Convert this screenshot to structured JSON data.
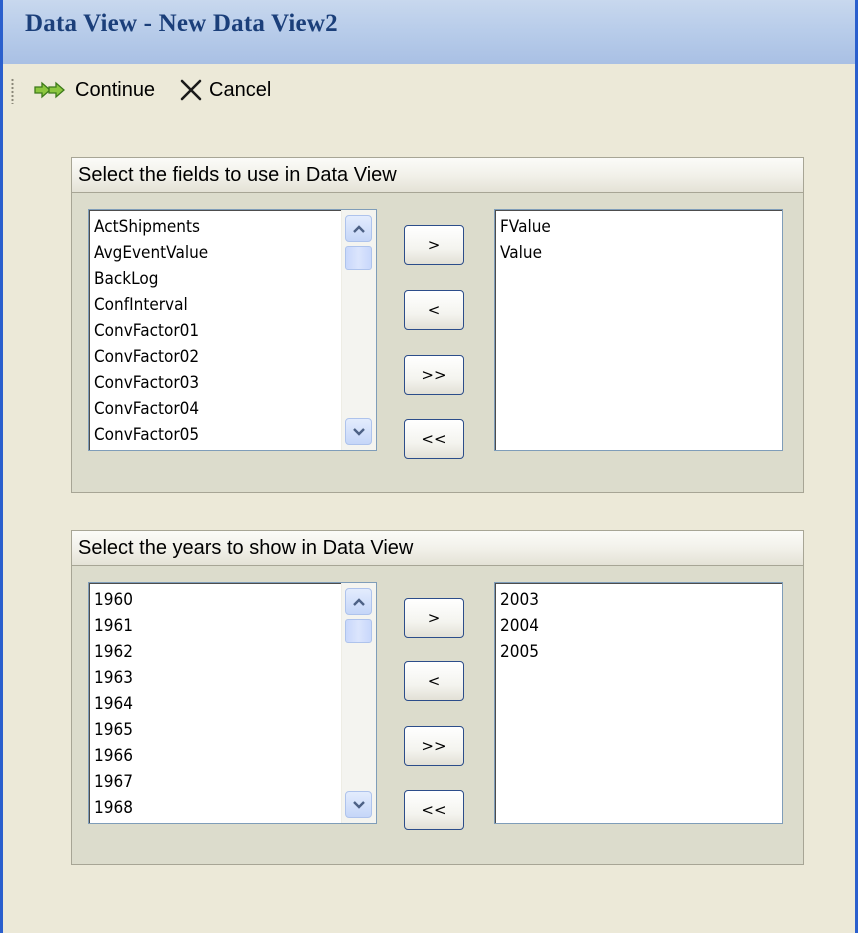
{
  "window": {
    "title": "Data View  - New Data View2",
    "border_color": "#2a5fcd",
    "title_color": "#1b3f7a"
  },
  "toolbar": {
    "continue_label": "Continue",
    "continue_icon": "double-arrow-right-icon",
    "cancel_label": "Cancel",
    "cancel_icon": "close-x-icon"
  },
  "fields_group": {
    "header": "Select the fields to use in Data View",
    "available": [
      "ActShipments",
      "AvgEventValue",
      "BackLog",
      "ConfInterval",
      "ConvFactor01",
      "ConvFactor02",
      "ConvFactor03",
      "ConvFactor04",
      "ConvFactor05"
    ],
    "selected": [
      "FValue",
      "Value"
    ],
    "buttons": {
      "add": ">",
      "remove": "<",
      "add_all": ">>",
      "remove_all": "<<"
    }
  },
  "years_group": {
    "header": "Select the years to show in Data View",
    "available": [
      "1960",
      "1961",
      "1962",
      "1963",
      "1964",
      "1965",
      "1966",
      "1967",
      "1968"
    ],
    "selected": [
      "2003",
      "2004",
      "2005"
    ],
    "buttons": {
      "add": ">",
      "remove": "<",
      "add_all": ">>",
      "remove_all": "<<"
    }
  }
}
